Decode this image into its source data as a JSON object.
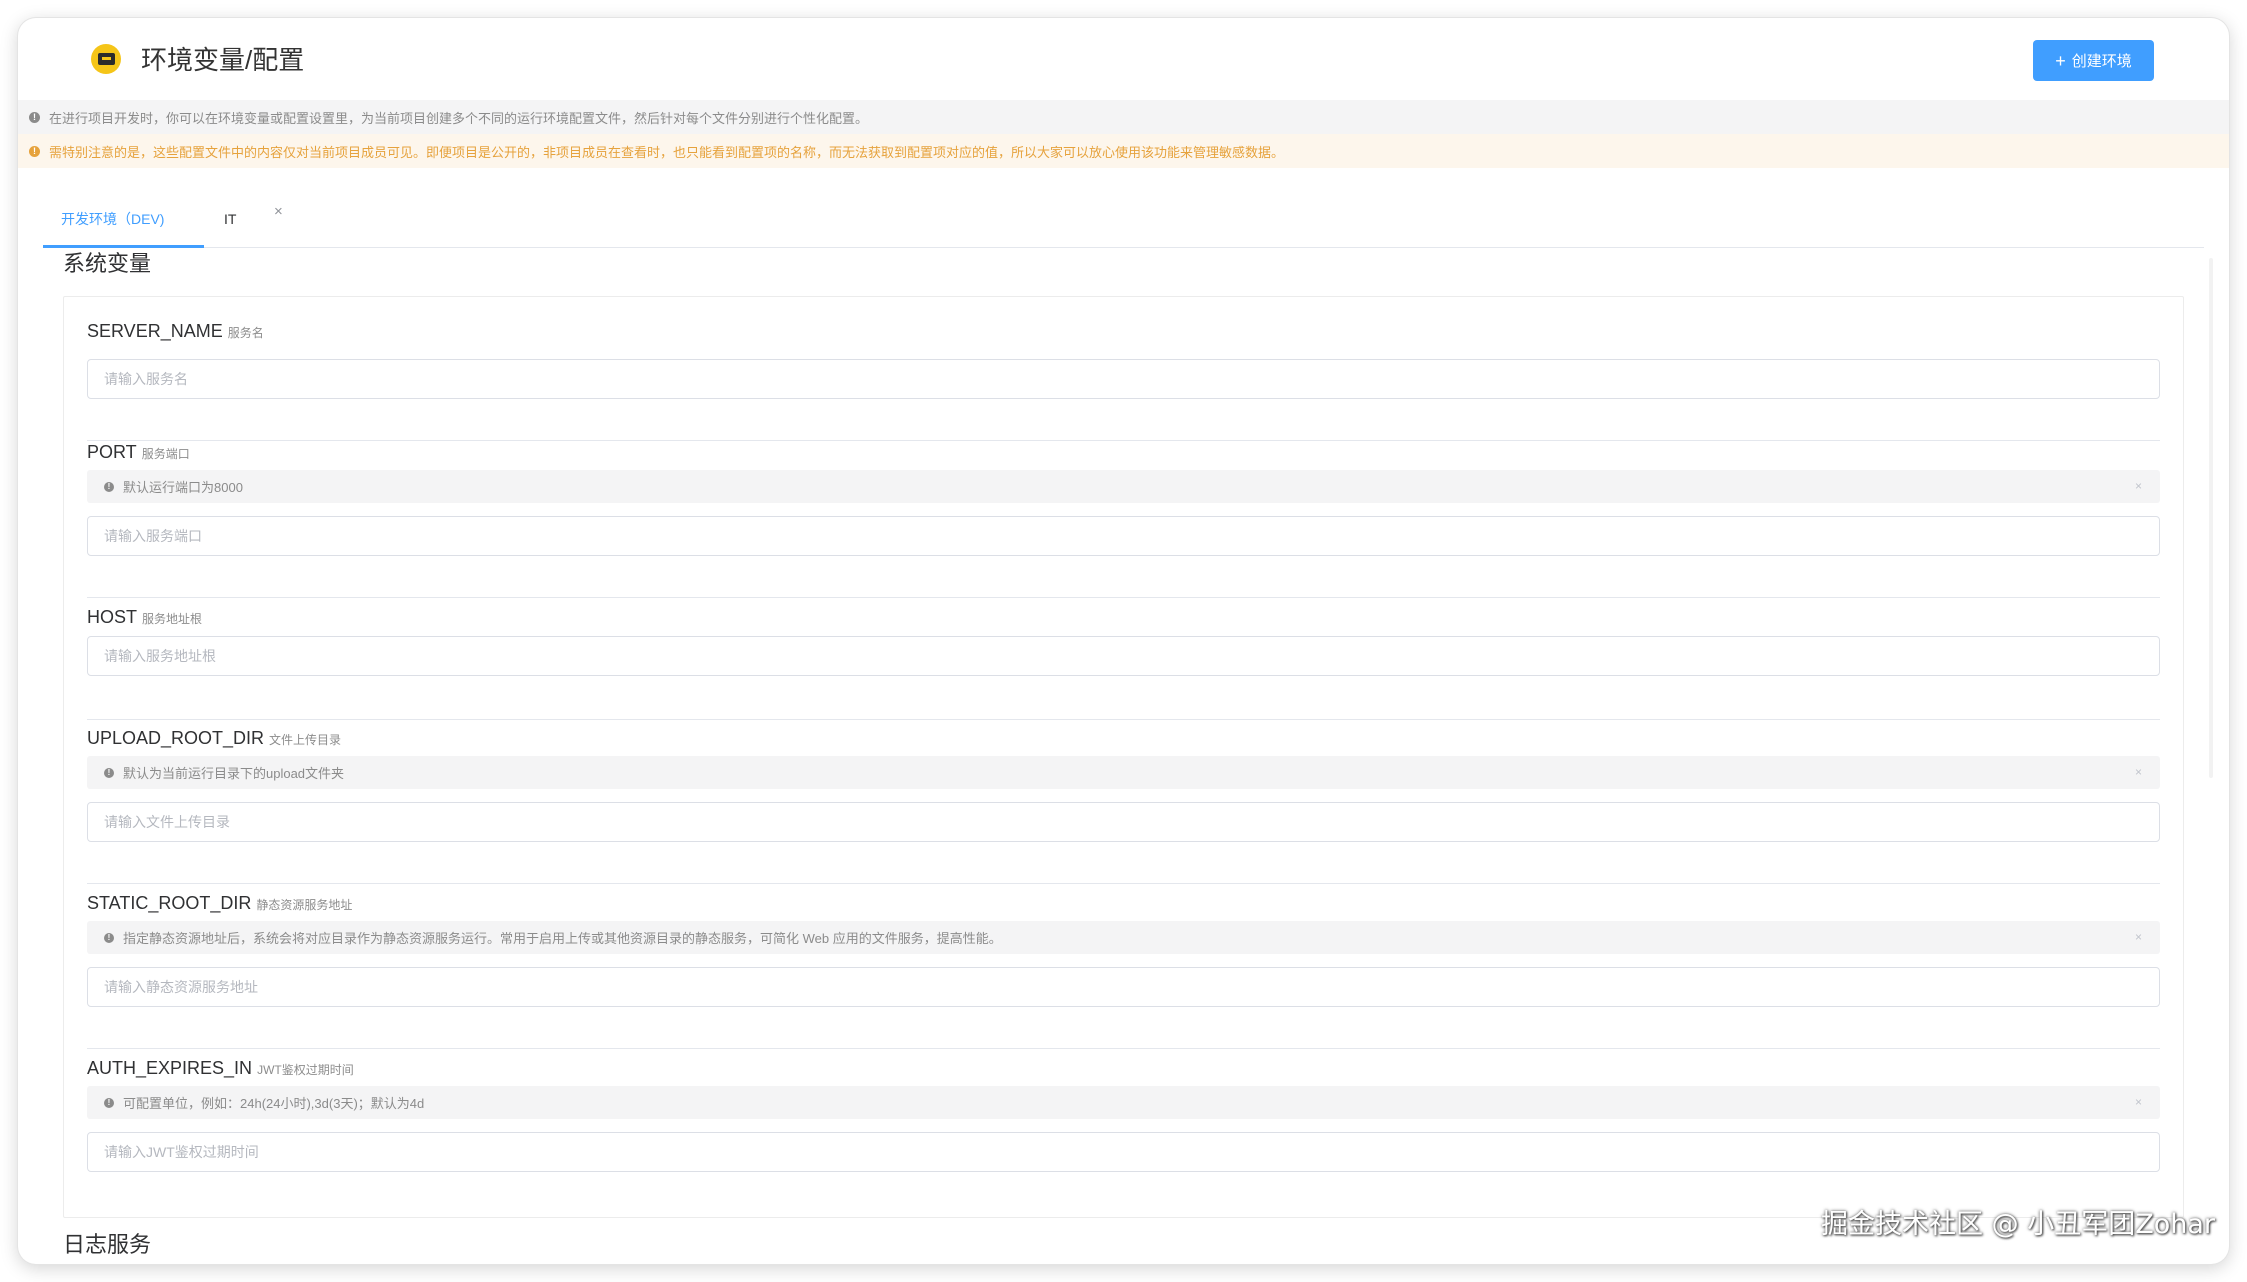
{
  "header": {
    "title": "环境变量/配置",
    "create_button_icon": "+",
    "create_button_label": "创建环境"
  },
  "notices": {
    "info_icon": "!",
    "info": "在进行项目开发时，你可以在环境变量或配置设置里，为当前项目创建多个不同的运行环境配置文件，然后针对每个文件分别进行个性化配置。",
    "warning_icon": "!",
    "warning": "需特别注意的是，这些配置文件中的内容仅对当前项目成员可见。即便项目是公开的，非项目成员在查看时，也只能看到配置项的名称，而无法获取到配置项对应的值，所以大家可以放心使用该功能来管理敏感数据。"
  },
  "tabs": [
    {
      "label": "开发环境（DEV)",
      "active": true
    },
    {
      "label": "IT",
      "active": false,
      "close": "×"
    }
  ],
  "sections": {
    "system": "系统变量",
    "log": "日志服务"
  },
  "fields": [
    {
      "key": "SERVER_NAME",
      "desc": "服务名",
      "hint": null,
      "placeholder": "请输入服务名"
    },
    {
      "key": "PORT",
      "desc": "服务端口",
      "hint": "默认运行端口为8000",
      "placeholder": "请输入服务端口"
    },
    {
      "key": "HOST",
      "desc": "服务地址根",
      "hint": null,
      "placeholder": "请输入服务地址根"
    },
    {
      "key": "UPLOAD_ROOT_DIR",
      "desc": "文件上传目录",
      "hint": "默认为当前运行目录下的upload文件夹",
      "placeholder": "请输入文件上传目录"
    },
    {
      "key": "STATIC_ROOT_DIR",
      "desc": "静态资源服务地址",
      "hint": "指定静态资源地址后，系统会将对应目录作为静态资源服务运行。常用于启用上传或其他资源目录的静态服务，可简化 Web 应用的文件服务，提高性能。",
      "placeholder": "请输入静态资源服务地址"
    },
    {
      "key": "AUTH_EXPIRES_IN",
      "desc": "JWT鉴权过期时间",
      "hint": "可配置单位，例如：24h(24小时),3d(3天)；默认为4d",
      "placeholder": "请输入JWT鉴权过期时间"
    }
  ],
  "hint_icon": "!",
  "hint_close": "×",
  "watermark": "掘金技术社区 @ 小丑军团Zohar",
  "colors": {
    "accent": "#409eff",
    "warning": "#e6a23c",
    "info_bg": "#f4f4f5",
    "warning_bg": "#fdf6ec",
    "logo": "#f5c518"
  }
}
